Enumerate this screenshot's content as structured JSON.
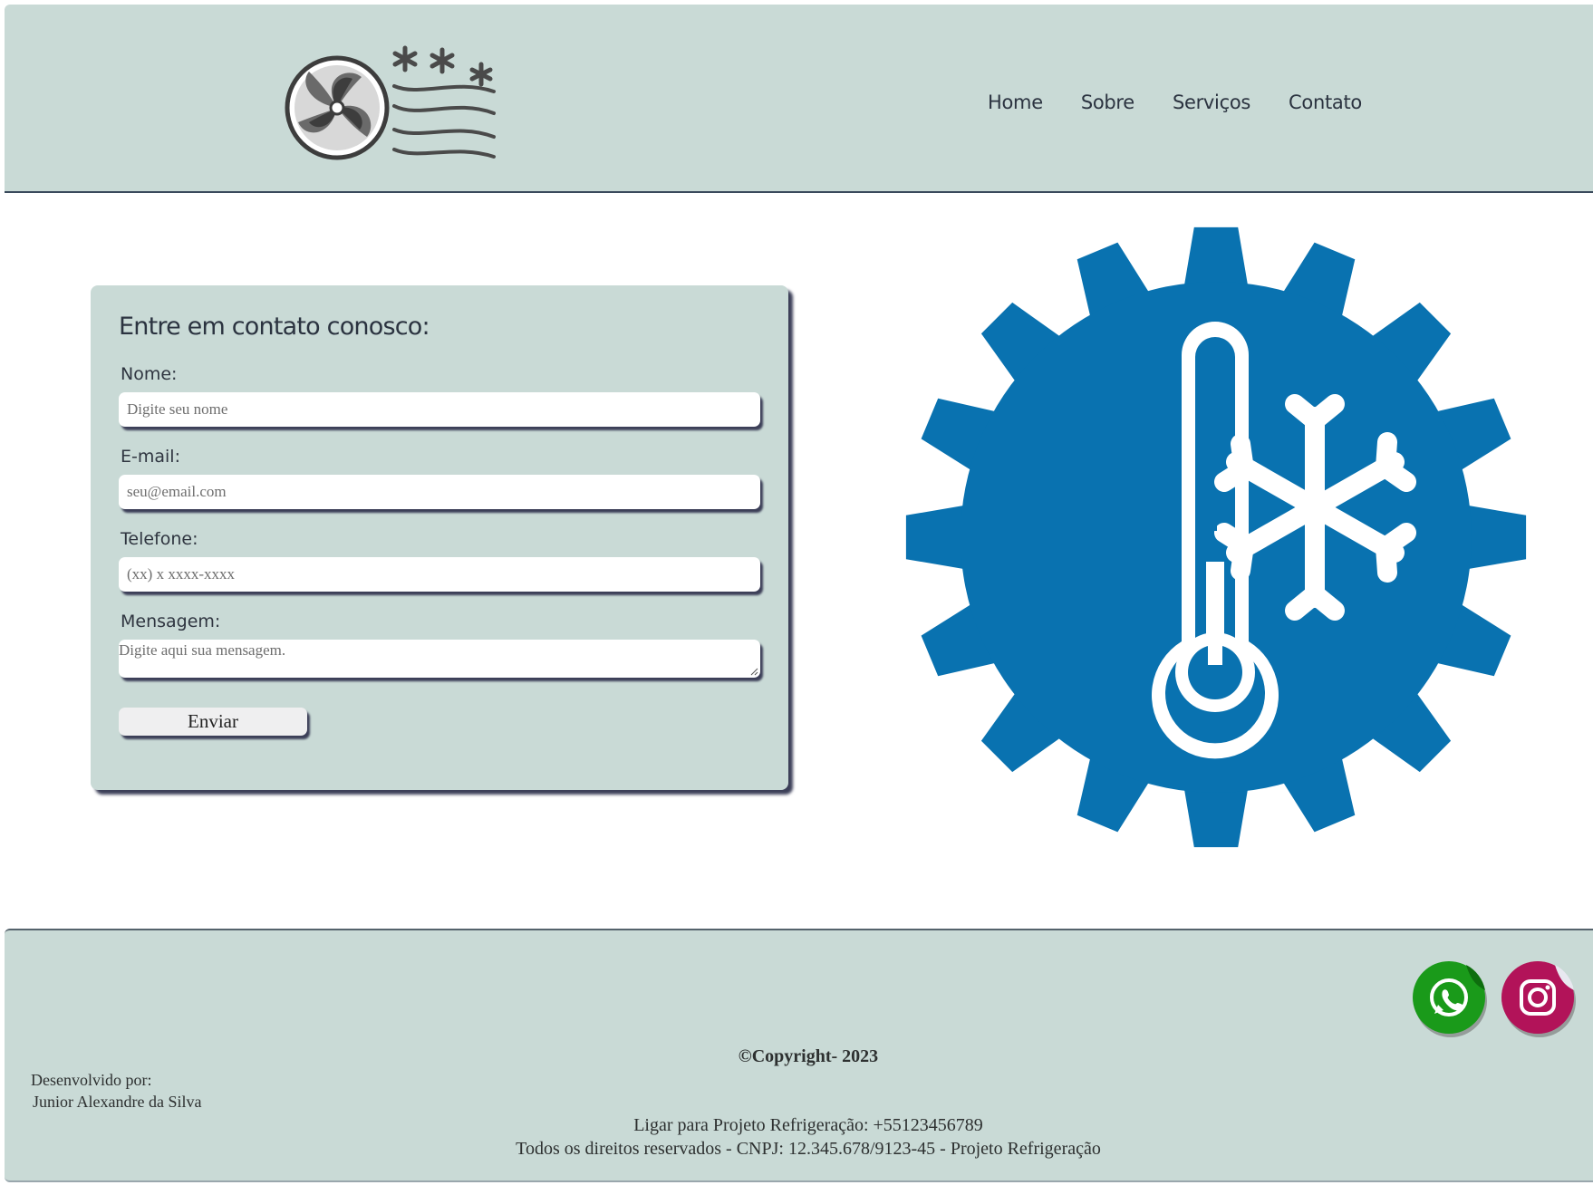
{
  "header": {
    "logo_icon": "fan-snowflake-wind-icon",
    "nav": [
      {
        "label": "Home"
      },
      {
        "label": "Sobre"
      },
      {
        "label": "Serviços"
      },
      {
        "label": "Contato"
      }
    ]
  },
  "form": {
    "title": "Entre em contato conosco:",
    "name_label": "Nome:",
    "name_placeholder": "Digite seu nome",
    "email_label": "E-mail:",
    "email_placeholder": "seu@email.com",
    "phone_label": "Telefone:",
    "phone_placeholder": "(xx) x xxxx-xxxx",
    "message_label": "Mensagem:",
    "message_placeholder": "Digite aqui sua mensagem.",
    "submit_label": "Enviar"
  },
  "hero": {
    "icon": "gear-thermometer-snowflake-icon",
    "color": "#0972b0"
  },
  "footer": {
    "developed_by": "Desenvolvido por:",
    "developer": "Junior Alexandre da Silva",
    "copyright": "©Copyright- 2023",
    "phone_line": "Ligar para Projeto Refrigeração: +55123456789",
    "rights_line": "Todos os direitos reservados - CNPJ: 12.345.678/9123-45 - Projeto Refrigeração",
    "social": [
      {
        "icon": "whatsapp-icon",
        "color": "#1a9a1a"
      },
      {
        "icon": "instagram-icon",
        "color": "#c8102e"
      }
    ]
  },
  "colors": {
    "panel_bg": "#c9dad6",
    "shadow": "#3c3f58",
    "accent_blue": "#0972b0"
  }
}
